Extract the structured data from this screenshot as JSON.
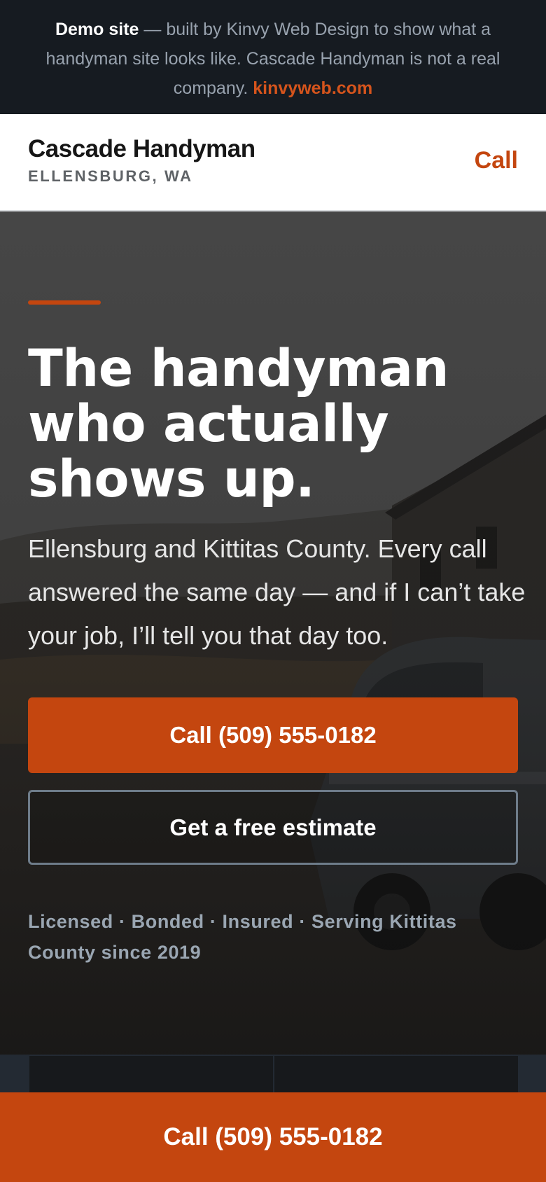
{
  "demo_banner": {
    "strong": "Demo site",
    "text": " — built by Kinvy Web Design to show what a handyman site looks like. Cascade Handyman is not a real company. ",
    "link": "kinvyweb.com"
  },
  "header": {
    "brand_name": "Cascade Handyman",
    "brand_location": "ELLENSBURG, WA",
    "call_label": "Call"
  },
  "hero": {
    "title": "The handyman who actually shows up.",
    "subtitle": "Ellensburg and Kittitas County. Every call answered the same day — and if I can’t take your job, I’ll tell you that day too.",
    "primary_button": "Call (509) 555-0182",
    "secondary_button": "Get a free estimate",
    "trust_line": "Licensed · Bonded · Insured · Serving Kittitas County since 2019"
  },
  "sticky_bar": {
    "call_label": "Call (509) 555-0182"
  },
  "colors": {
    "accent": "#c4460f",
    "banner_bg": "#161b21",
    "header_bg": "#ffffff"
  }
}
